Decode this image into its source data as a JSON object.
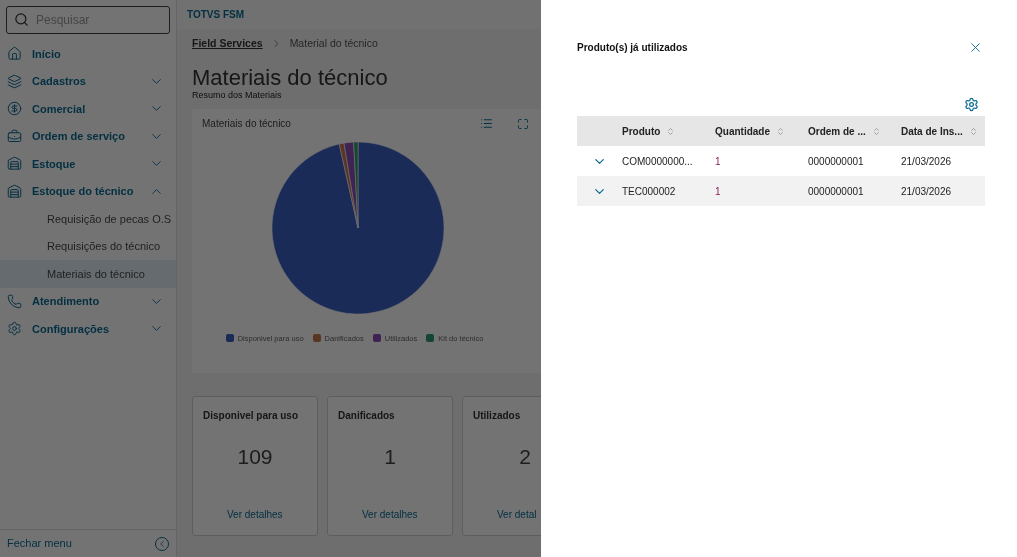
{
  "sidebar": {
    "search": {
      "placeholder": "Pesquisar"
    },
    "items": [
      {
        "kind": "link",
        "label": "Início"
      },
      {
        "kind": "group",
        "label": "Cadastros",
        "expanded": false
      },
      {
        "kind": "group",
        "label": "Comercial",
        "expanded": false
      },
      {
        "kind": "group",
        "label": "Ordem de serviço",
        "expanded": false
      },
      {
        "kind": "group",
        "label": "Estoque",
        "expanded": false
      },
      {
        "kind": "group",
        "label": "Estoque do técnico",
        "expanded": true,
        "children": [
          {
            "label": "Requisição de pecas O.S",
            "selected": false
          },
          {
            "label": "Requisições do técnico",
            "selected": false
          },
          {
            "label": "Materiais do técnico",
            "selected": true
          }
        ]
      },
      {
        "kind": "group",
        "label": "Atendimento",
        "expanded": false
      },
      {
        "kind": "group",
        "label": "Configurações",
        "expanded": false
      }
    ],
    "footer": "Fechar menu"
  },
  "header": {
    "title": "TOTVS FSM"
  },
  "breadcrumb": [
    {
      "label": "Field Services",
      "kind": "link"
    },
    {
      "label": "Material do técnico",
      "kind": "current"
    }
  ],
  "page_title": "Materiais do técnico",
  "section_title": "Resumo dos Materiais",
  "chart_card": {
    "title": "Materiais do técnico",
    "chart_data": {
      "type": "pie",
      "categories": [
        "Disponivel para uso",
        "Danificados",
        "Utilizados",
        "Kit do técnico"
      ],
      "values": [
        96.5,
        0.9,
        1.8,
        0.8
      ],
      "colors": [
        "#3b5fc4",
        "#c8754f",
        "#8a4fb8",
        "#2f9a72"
      ]
    }
  },
  "summary_cards": [
    {
      "title": "Disponivel para uso",
      "value": "109",
      "link": "Ver detalhes"
    },
    {
      "title": "Danificados",
      "value": "1",
      "link": "Ver detalhes"
    },
    {
      "title": "Utilizados",
      "value": "2",
      "link": "Ver detal"
    }
  ],
  "drawer": {
    "title": "Produto(s) já utilizados",
    "table": {
      "columns": [
        "Produto",
        "Quantidade",
        "Ordem de ...",
        "Data de Ins..."
      ],
      "rows": [
        {
          "cells": [
            "COM0000000...",
            "1",
            "0000000001",
            "21/03/2026"
          ],
          "expanded": false
        },
        {
          "cells": [
            "TEC000002",
            "1",
            "0000000001",
            "21/03/2026"
          ],
          "expanded": false
        }
      ]
    }
  }
}
